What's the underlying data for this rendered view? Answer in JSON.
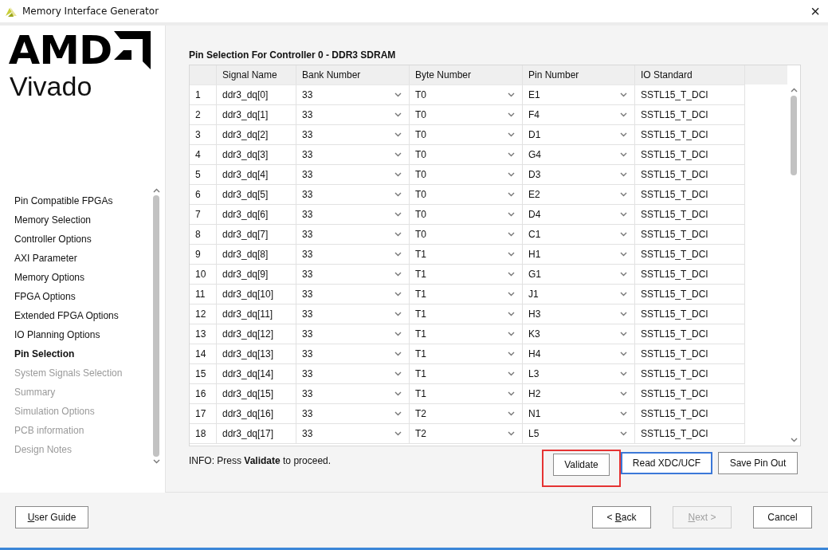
{
  "window": {
    "title": "Memory Interface Generator",
    "close": "×"
  },
  "logo": {
    "brand": "AMD",
    "product": "Vivado"
  },
  "sidebar": {
    "items": [
      {
        "label": "Pin Compatible FPGAs",
        "selected": false,
        "disabled": false
      },
      {
        "label": "Memory Selection",
        "selected": false,
        "disabled": false
      },
      {
        "label": "Controller Options",
        "selected": false,
        "disabled": false
      },
      {
        "label": "AXI Parameter",
        "selected": false,
        "disabled": false
      },
      {
        "label": "Memory Options",
        "selected": false,
        "disabled": false
      },
      {
        "label": "FPGA Options",
        "selected": false,
        "disabled": false
      },
      {
        "label": "Extended FPGA Options",
        "selected": false,
        "disabled": false
      },
      {
        "label": "IO Planning Options",
        "selected": false,
        "disabled": false
      },
      {
        "label": "Pin Selection",
        "selected": true,
        "disabled": false
      },
      {
        "label": "System Signals Selection",
        "selected": false,
        "disabled": true
      },
      {
        "label": "Summary",
        "selected": false,
        "disabled": true
      },
      {
        "label": "Simulation Options",
        "selected": false,
        "disabled": true
      },
      {
        "label": "PCB information",
        "selected": false,
        "disabled": true
      },
      {
        "label": "Design Notes",
        "selected": false,
        "disabled": true
      }
    ]
  },
  "panel_title": "Pin Selection For Controller 0 - DDR3 SDRAM",
  "table": {
    "columns": [
      "Signal Name",
      "Bank Number",
      "Byte Number",
      "Pin Number",
      "IO Standard"
    ],
    "rows": [
      {
        "index": "1",
        "signal": "ddr3_dq[0]",
        "bank": "33",
        "byte": "T0",
        "pin": "E1",
        "io_standard": "SSTL15_T_DCI"
      },
      {
        "index": "2",
        "signal": "ddr3_dq[1]",
        "bank": "33",
        "byte": "T0",
        "pin": "F4",
        "io_standard": "SSTL15_T_DCI"
      },
      {
        "index": "3",
        "signal": "ddr3_dq[2]",
        "bank": "33",
        "byte": "T0",
        "pin": "D1",
        "io_standard": "SSTL15_T_DCI"
      },
      {
        "index": "4",
        "signal": "ddr3_dq[3]",
        "bank": "33",
        "byte": "T0",
        "pin": "G4",
        "io_standard": "SSTL15_T_DCI"
      },
      {
        "index": "5",
        "signal": "ddr3_dq[4]",
        "bank": "33",
        "byte": "T0",
        "pin": "D3",
        "io_standard": "SSTL15_T_DCI"
      },
      {
        "index": "6",
        "signal": "ddr3_dq[5]",
        "bank": "33",
        "byte": "T0",
        "pin": "E2",
        "io_standard": "SSTL15_T_DCI"
      },
      {
        "index": "7",
        "signal": "ddr3_dq[6]",
        "bank": "33",
        "byte": "T0",
        "pin": "D4",
        "io_standard": "SSTL15_T_DCI"
      },
      {
        "index": "8",
        "signal": "ddr3_dq[7]",
        "bank": "33",
        "byte": "T0",
        "pin": "C1",
        "io_standard": "SSTL15_T_DCI"
      },
      {
        "index": "9",
        "signal": "ddr3_dq[8]",
        "bank": "33",
        "byte": "T1",
        "pin": "H1",
        "io_standard": "SSTL15_T_DCI"
      },
      {
        "index": "10",
        "signal": "ddr3_dq[9]",
        "bank": "33",
        "byte": "T1",
        "pin": "G1",
        "io_standard": "SSTL15_T_DCI"
      },
      {
        "index": "11",
        "signal": "ddr3_dq[10]",
        "bank": "33",
        "byte": "T1",
        "pin": "J1",
        "io_standard": "SSTL15_T_DCI"
      },
      {
        "index": "12",
        "signal": "ddr3_dq[11]",
        "bank": "33",
        "byte": "T1",
        "pin": "H3",
        "io_standard": "SSTL15_T_DCI"
      },
      {
        "index": "13",
        "signal": "ddr3_dq[12]",
        "bank": "33",
        "byte": "T1",
        "pin": "K3",
        "io_standard": "SSTL15_T_DCI"
      },
      {
        "index": "14",
        "signal": "ddr3_dq[13]",
        "bank": "33",
        "byte": "T1",
        "pin": "H4",
        "io_standard": "SSTL15_T_DCI"
      },
      {
        "index": "15",
        "signal": "ddr3_dq[14]",
        "bank": "33",
        "byte": "T1",
        "pin": "L3",
        "io_standard": "SSTL15_T_DCI"
      },
      {
        "index": "16",
        "signal": "ddr3_dq[15]",
        "bank": "33",
        "byte": "T1",
        "pin": "H2",
        "io_standard": "SSTL15_T_DCI"
      },
      {
        "index": "17",
        "signal": "ddr3_dq[16]",
        "bank": "33",
        "byte": "T2",
        "pin": "N1",
        "io_standard": "SSTL15_T_DCI"
      },
      {
        "index": "18",
        "signal": "ddr3_dq[17]",
        "bank": "33",
        "byte": "T2",
        "pin": "L5",
        "io_standard": "SSTL15_T_DCI"
      }
    ]
  },
  "info": "INFO: Press **Validate** to proceed.",
  "actions": [
    {
      "label": "Validate",
      "highlighted": true,
      "focused": false
    },
    {
      "label": "Read XDC/UCF",
      "highlighted": false,
      "focused": true
    },
    {
      "label": "Save Pin Out",
      "highlighted": false,
      "focused": false
    }
  ],
  "footer": {
    "left": [
      {
        "label": "User Guide",
        "mnemonic": true,
        "disabled": false
      }
    ],
    "right": [
      {
        "label": "< Back",
        "mnemonic": true,
        "disabled": false
      },
      {
        "label": "Next >",
        "mnemonic": true,
        "disabled": true
      },
      {
        "label": "Cancel",
        "mnemonic": false,
        "disabled": false
      }
    ]
  }
}
